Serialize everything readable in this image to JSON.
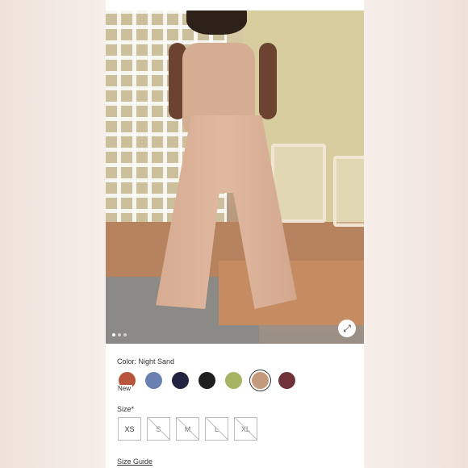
{
  "product": {
    "color_label": "Color: Night Sand",
    "swatches": [
      {
        "name": "terracotta",
        "color": "#b8553a",
        "badge": "New"
      },
      {
        "name": "blue",
        "color": "#6a80b2"
      },
      {
        "name": "navy",
        "color": "#22243f"
      },
      {
        "name": "black",
        "color": "#1d1f1d"
      },
      {
        "name": "sage",
        "color": "#a6b464"
      },
      {
        "name": "night-sand",
        "color": "#c49a7c",
        "selected": true
      },
      {
        "name": "plum",
        "color": "#6e3238"
      }
    ],
    "size_label": "Size*",
    "sizes": [
      {
        "label": "XS",
        "available": true
      },
      {
        "label": "S",
        "available": false
      },
      {
        "label": "M",
        "available": false
      },
      {
        "label": "L",
        "available": false
      },
      {
        "label": "XL",
        "available": false
      }
    ],
    "size_guide": "Size Guide"
  },
  "gallery": {
    "zoom_icon": "expand-icon",
    "dots": 3,
    "active_dot": 1
  }
}
